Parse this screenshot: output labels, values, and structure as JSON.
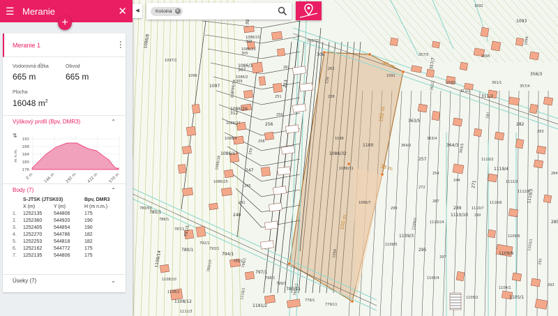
{
  "header": {
    "title": "Meranie"
  },
  "measurement": {
    "name": "Meranie 1",
    "horizontal_label": "Vodorovná dĺžka",
    "horizontal_value": "665 m",
    "perimeter_label": "Obvod",
    "perimeter_value": "665 m",
    "area_label": "Plocha",
    "area_value": "16048 m",
    "area_unit_exp": "2"
  },
  "profile": {
    "title": "Výškový profil (Bpv, DMR3)",
    "y_unit": "m n.m.",
    "y_ticks": [
      "192",
      "188",
      "184",
      "180",
      "176"
    ],
    "x_ticks": [
      "0 m",
      "146 m",
      "292 m",
      "432 m",
      "570 m"
    ]
  },
  "points": {
    "title": "Body (7)",
    "header_system": "S-JTSK (JTSK03)",
    "header_height_system": "Bpv, DMR3",
    "col_x": "X (m)",
    "col_y": "Y (m)",
    "col_h": "H (m n.m.)",
    "rows": [
      {
        "i": "1.",
        "x": "1252135",
        "y": "544806",
        "h": "175"
      },
      {
        "i": "2.",
        "x": "1252360",
        "y": "544920",
        "h": "190"
      },
      {
        "i": "3.",
        "x": "1252405",
        "y": "544854",
        "h": "190"
      },
      {
        "i": "4.",
        "x": "1252270",
        "y": "544786",
        "h": "182"
      },
      {
        "i": "5.",
        "x": "1252253",
        "y": "544818",
        "h": "182"
      },
      {
        "i": "6.",
        "x": "1252162",
        "y": "544772",
        "h": "175"
      },
      {
        "i": "7.",
        "x": "1252135",
        "y": "544806",
        "h": "175"
      }
    ]
  },
  "segments": {
    "title": "Úseky (7)"
  },
  "search": {
    "chip": "Košolná",
    "placeholder": ""
  },
  "map": {
    "parcels": [
      "1086/45",
      "1086/15",
      "1086/11",
      "1086/3",
      "1086/2",
      "1086/34",
      "1086/26",
      "1086/27",
      "1086/9",
      "1086/17",
      "1086/18",
      "1086/25",
      "1086/32",
      "1086/31",
      "1086/7",
      "1086/8",
      "1097/1",
      "1096",
      "1097",
      "1098",
      "1099",
      "1100",
      "1091",
      "1092",
      "1093",
      "1094",
      "1095",
      "356/3",
      "357/4",
      "357/5",
      "357/7",
      "258/1",
      "311/1",
      "311/2",
      "361/1",
      "362/2",
      "363/5",
      "363/4",
      "364/2",
      "364/3",
      "364/5",
      "1119/2",
      "1119/4",
      "1112/2",
      "1112/8",
      "1110/3",
      "1110/6",
      "1110/7",
      "1110/10",
      "1110/14",
      "1109/2",
      "1109/3",
      "1109/5",
      "1109/6",
      "1109/9",
      "1103/1",
      "1104/1",
      "1105/1",
      "1105/2",
      "1106/4",
      "1108/14",
      "1108/10",
      "1108/2",
      "1108/12",
      "1111/3",
      "1119/1",
      "1191/2",
      "779/1",
      "779/11",
      "780/1",
      "780/10",
      "780/50",
      "785/1",
      "786/1",
      "787/1",
      "791/1",
      "792/1",
      "793/1",
      "794/1",
      "795/1",
      "796/1",
      "797/1",
      "798/1",
      "799/1",
      "780/11",
      "780/12",
      "780/21",
      "308",
      "262",
      "261",
      "253",
      "251",
      "250",
      "256",
      "258",
      "259",
      "247",
      "245",
      "241",
      "240",
      "239",
      "238",
      "257",
      "254",
      "244",
      "271",
      "272",
      "287",
      "289",
      "290",
      "281",
      "282",
      "283",
      "284",
      "285",
      "292",
      "293",
      "295",
      "297",
      "299",
      "301",
      "303",
      "305",
      "307",
      "309",
      "310",
      "312"
    ],
    "distances": [
      "42 m",
      "102 m",
      "38 m",
      "100 m"
    ]
  },
  "colors": {
    "accent": "#e91e63",
    "polygon": "#d9a87a",
    "road": "#8fd8d0"
  }
}
